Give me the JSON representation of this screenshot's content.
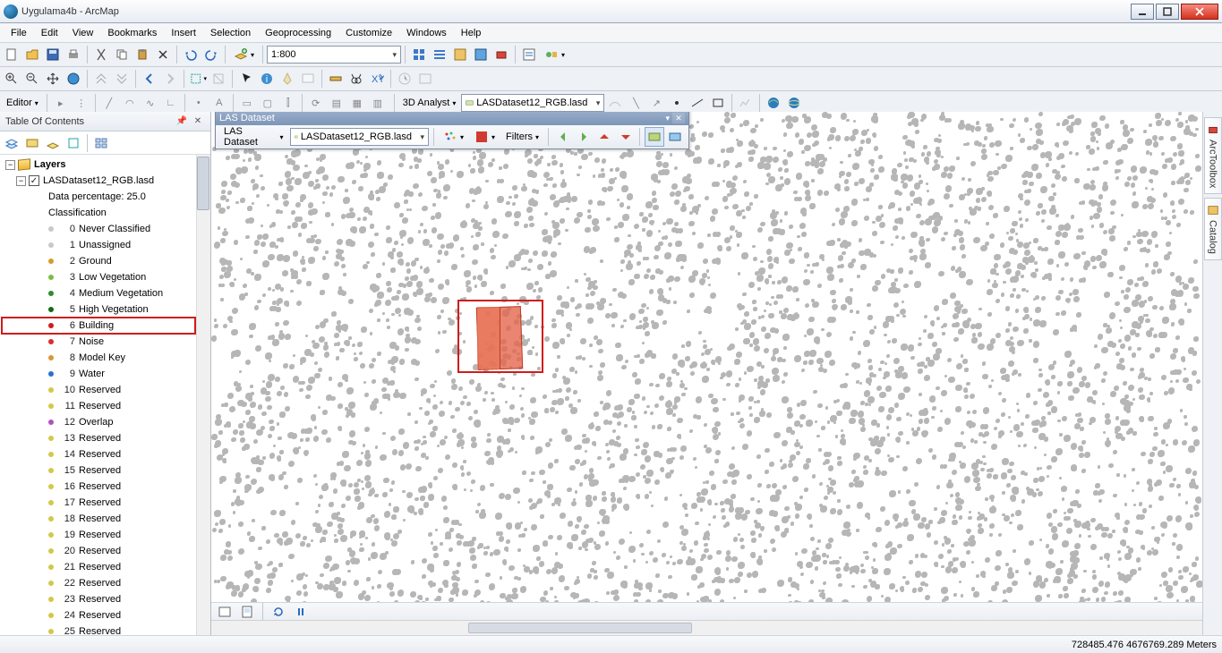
{
  "window": {
    "title": "Uygulama4b - ArcMap"
  },
  "menu": [
    "File",
    "Edit",
    "View",
    "Bookmarks",
    "Insert",
    "Selection",
    "Geoprocessing",
    "Customize",
    "Windows",
    "Help"
  ],
  "scale_combo": "1:800",
  "editor_label": "Editor",
  "analyst_label": "3D Analyst",
  "analyst_layer": "LASDataset12_RGB.lasd",
  "toc": {
    "title": "Table Of Contents",
    "root": "Layers",
    "dataset": "LASDataset12_RGB.lasd",
    "percentage": "Data percentage: 25.0",
    "classification_label": "Classification",
    "classes": [
      {
        "n": "0",
        "name": "Never Classified",
        "c": "#c9c9c9"
      },
      {
        "n": "1",
        "name": "Unassigned",
        "c": "#c9c9c9"
      },
      {
        "n": "2",
        "name": "Ground",
        "c": "#d89a2d"
      },
      {
        "n": "3",
        "name": "Low Vegetation",
        "c": "#7bbf3e"
      },
      {
        "n": "4",
        "name": "Medium Vegetation",
        "c": "#2d8e2d"
      },
      {
        "n": "5",
        "name": "High Vegetation",
        "c": "#136b13"
      },
      {
        "n": "6",
        "name": "Building",
        "c": "#cf1c1c",
        "hl": true
      },
      {
        "n": "7",
        "name": "Noise",
        "c": "#d92e2e"
      },
      {
        "n": "8",
        "name": "Model Key",
        "c": "#d8973a"
      },
      {
        "n": "9",
        "name": "Water",
        "c": "#2d6fd3"
      },
      {
        "n": "10",
        "name": "Reserved",
        "c": "#d2c84c"
      },
      {
        "n": "11",
        "name": "Reserved",
        "c": "#d2c84c"
      },
      {
        "n": "12",
        "name": "Overlap",
        "c": "#b24fc2"
      },
      {
        "n": "13",
        "name": "Reserved",
        "c": "#d2c84c"
      },
      {
        "n": "14",
        "name": "Reserved",
        "c": "#d2c84c"
      },
      {
        "n": "15",
        "name": "Reserved",
        "c": "#d2c84c"
      },
      {
        "n": "16",
        "name": "Reserved",
        "c": "#d2c84c"
      },
      {
        "n": "17",
        "name": "Reserved",
        "c": "#d2c84c"
      },
      {
        "n": "18",
        "name": "Reserved",
        "c": "#d2c84c"
      },
      {
        "n": "19",
        "name": "Reserved",
        "c": "#d2c84c"
      },
      {
        "n": "20",
        "name": "Reserved",
        "c": "#d2c84c"
      },
      {
        "n": "21",
        "name": "Reserved",
        "c": "#d2c84c"
      },
      {
        "n": "22",
        "name": "Reserved",
        "c": "#d2c84c"
      },
      {
        "n": "23",
        "name": "Reserved",
        "c": "#d2c84c"
      },
      {
        "n": "24",
        "name": "Reserved",
        "c": "#d2c84c"
      },
      {
        "n": "25",
        "name": "Reserved",
        "c": "#d2c84c"
      }
    ]
  },
  "las_toolbar": {
    "title": "LAS Dataset",
    "dd_label": "LAS Dataset",
    "layer": "LASDataset12_RGB.lasd",
    "filters_label": "Filters"
  },
  "right_tabs": [
    "ArcToolbox",
    "Catalog"
  ],
  "status": {
    "coords": "728485.476 4676769.289 Meters"
  }
}
